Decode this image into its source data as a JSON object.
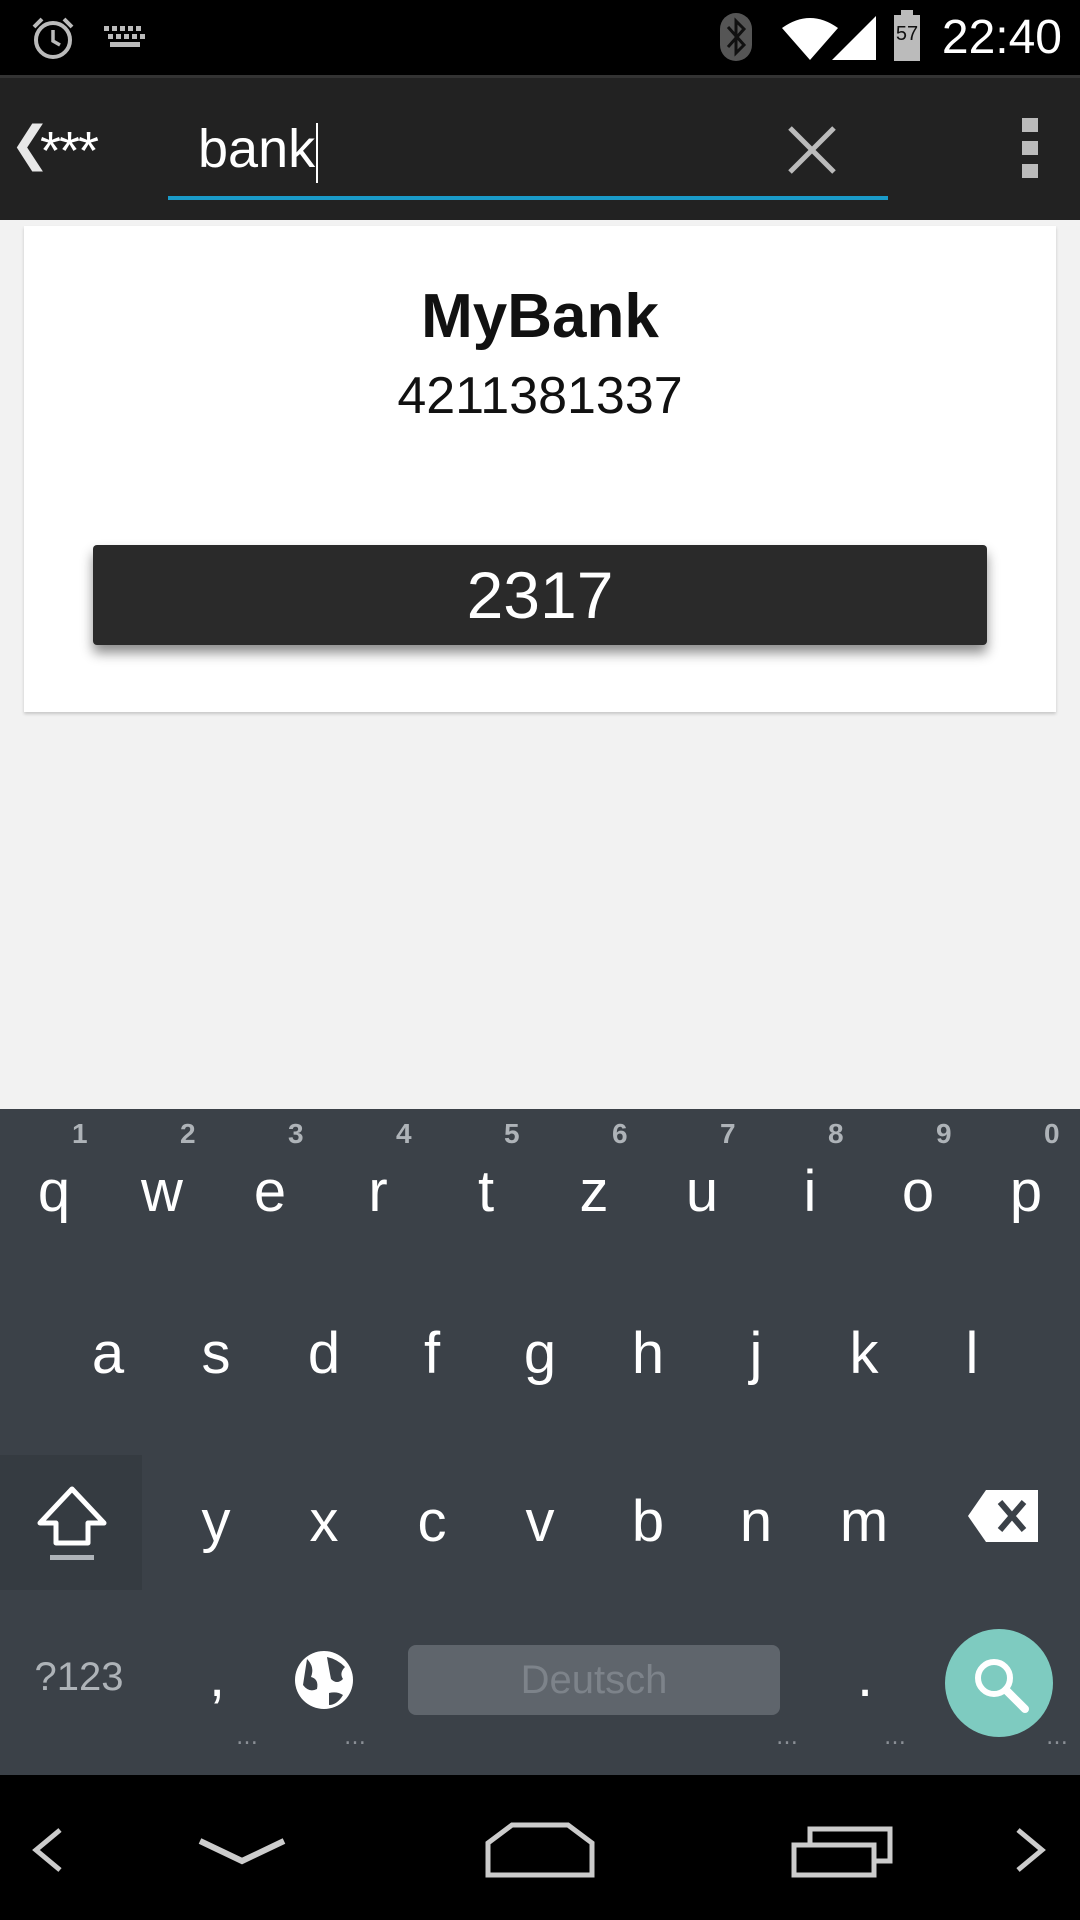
{
  "status_bar": {
    "time": "22:40",
    "battery_level": "57",
    "icons": [
      "alarm-icon",
      "keyboard-icon",
      "bluetooth-icon",
      "wifi-icon",
      "signal-icon",
      "battery-icon"
    ]
  },
  "action_bar": {
    "back_glyph": "❮",
    "app_mark": "***",
    "search": {
      "value": "bank"
    },
    "icons": [
      "clear-icon",
      "overflow-menu-icon"
    ]
  },
  "result_card": {
    "name": "MyBank",
    "number": "4211381337",
    "code": "2317"
  },
  "keyboard": {
    "row1": [
      {
        "key": "q",
        "hint": "1"
      },
      {
        "key": "w",
        "hint": "2"
      },
      {
        "key": "e",
        "hint": "3"
      },
      {
        "key": "r",
        "hint": "4"
      },
      {
        "key": "t",
        "hint": "5"
      },
      {
        "key": "z",
        "hint": "6"
      },
      {
        "key": "u",
        "hint": "7"
      },
      {
        "key": "i",
        "hint": "8"
      },
      {
        "key": "o",
        "hint": "9"
      },
      {
        "key": "p",
        "hint": "0"
      }
    ],
    "row2": [
      "a",
      "s",
      "d",
      "f",
      "g",
      "h",
      "j",
      "k",
      "l"
    ],
    "row3": [
      "y",
      "x",
      "c",
      "v",
      "b",
      "n",
      "m"
    ],
    "symbols_label": "?123",
    "comma": ",",
    "period": ".",
    "space_label": "Deutsch",
    "icons": [
      "shift-icon",
      "backspace-icon",
      "globe-icon",
      "search-icon"
    ]
  },
  "nav_bar": {
    "icons": [
      "nav-left-icon",
      "hide-keyboard-icon",
      "home-icon",
      "recents-icon",
      "nav-right-icon"
    ]
  },
  "colors": {
    "accent": "#1a9bc9",
    "action_bar": "#222222",
    "keyboard_bg": "#3b4148",
    "search_key": "#7ecbc0",
    "code_button": "#2a2a2a"
  }
}
